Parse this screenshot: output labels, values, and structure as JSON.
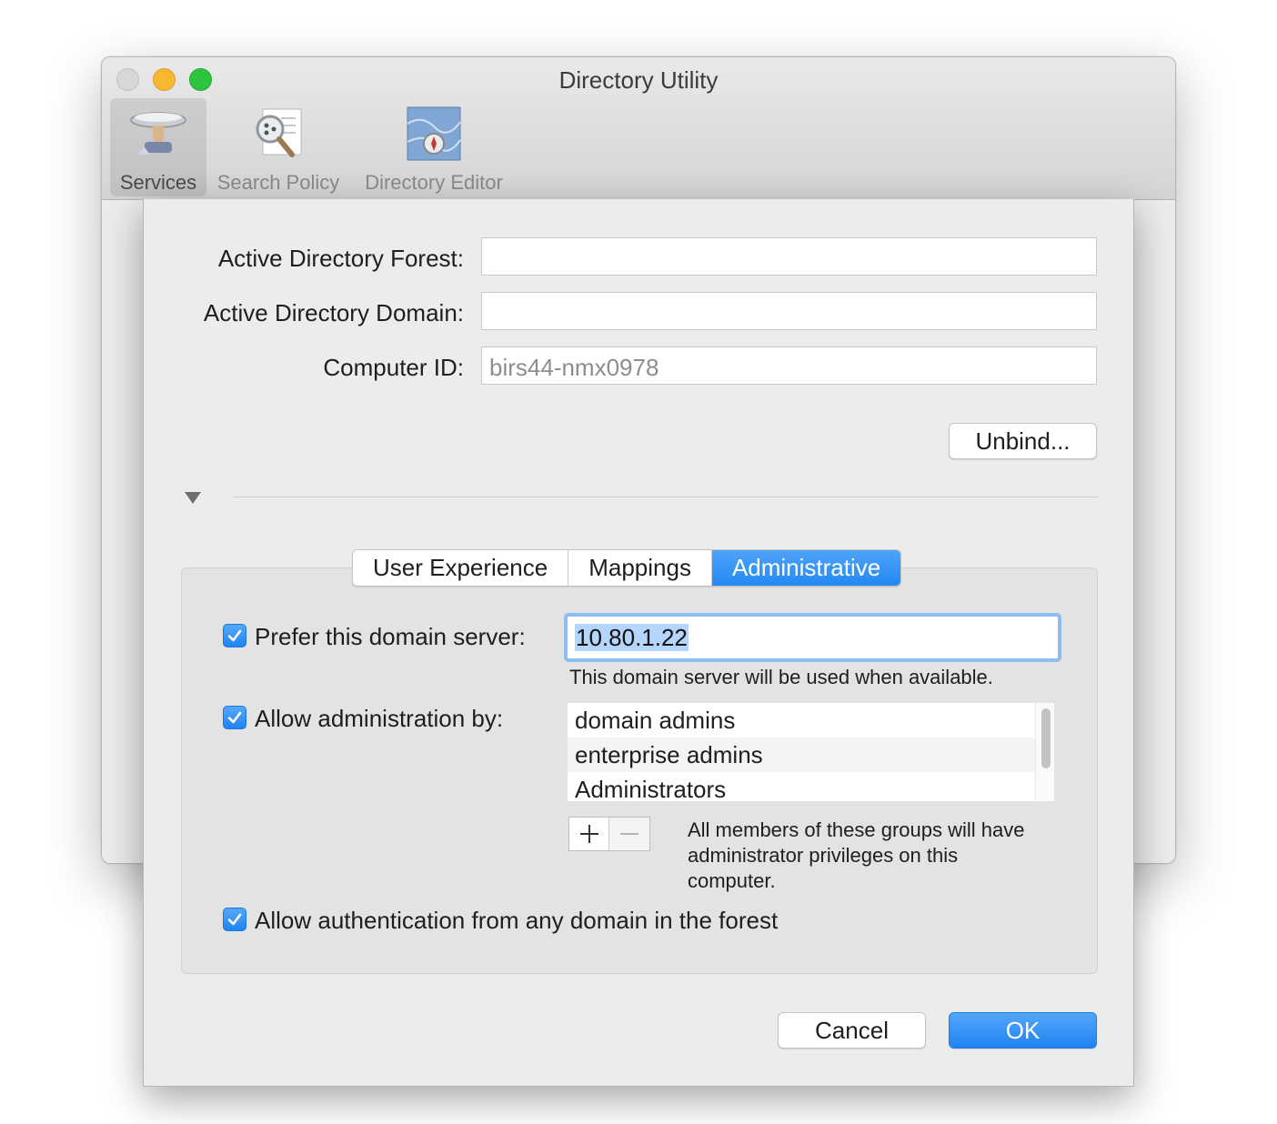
{
  "window": {
    "title": "Directory Utility",
    "toolbar": [
      {
        "label": "Services",
        "icon": "services-icon",
        "selected": true
      },
      {
        "label": "Search Policy",
        "icon": "search-policy-icon",
        "selected": false
      },
      {
        "label": "Directory Editor",
        "icon": "directory-editor-icon",
        "selected": false
      }
    ]
  },
  "sheet": {
    "fields": {
      "forest_label": "Active Directory Forest:",
      "forest_value": "",
      "domain_label": "Active Directory Domain:",
      "domain_value": "",
      "computer_id_label": "Computer ID:",
      "computer_id_value": "birs44-nmx0978"
    },
    "unbind_label": "Unbind...",
    "tabs": [
      {
        "label": "User Experience",
        "active": false
      },
      {
        "label": "Mappings",
        "active": false
      },
      {
        "label": "Administrative",
        "active": true
      }
    ],
    "administrative": {
      "prefer_server_label": "Prefer this domain server:",
      "prefer_server_checked": true,
      "server_value": "10.80.1.22",
      "server_hint": "This domain server will be used when available.",
      "allow_admin_label": "Allow administration by:",
      "allow_admin_checked": true,
      "admin_groups": [
        "domain admins",
        "enterprise admins",
        "Administrators"
      ],
      "admin_hint": [
        "All members of these groups will have",
        "administrator privileges on this",
        "computer."
      ],
      "allow_auth_label": "Allow authentication from any domain in the forest",
      "allow_auth_checked": true
    },
    "cancel_label": "Cancel",
    "ok_label": "OK"
  },
  "colors": {
    "accent": "#2389f3",
    "focus_ring": "#8dbdf3",
    "selection": "#b4d5fc",
    "traffic_close": "#d7d7d7",
    "traffic_minimize": "#f7b731",
    "traffic_maximize": "#2dc43f"
  }
}
